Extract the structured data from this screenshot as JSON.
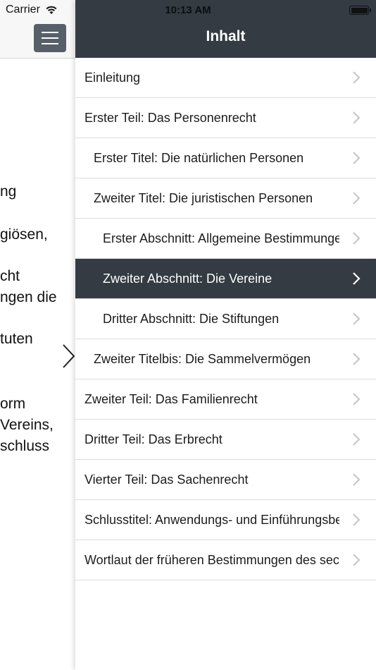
{
  "status_bar": {
    "carrier": "Carrier",
    "time": "10:13 AM"
  },
  "left_pane": {
    "peek_lines": [
      "ng",
      "giösen,",
      "cht",
      "ngen die",
      "tuten",
      "orm",
      "Vereins,",
      "schluss"
    ]
  },
  "menu": {
    "title": "Inhalt",
    "items": [
      {
        "label": "Einleitung",
        "level": 0,
        "selected": false
      },
      {
        "label": "Erster Teil: Das Personenrecht",
        "level": 0,
        "selected": false
      },
      {
        "label": "Erster Titel: Die natürlichen Personen",
        "level": 1,
        "selected": false
      },
      {
        "label": "Zweiter Titel: Die juristischen Personen",
        "level": 1,
        "selected": false
      },
      {
        "label": "Erster Abschnitt: Allgemeine Bestimmungen",
        "level": 2,
        "selected": false
      },
      {
        "label": "Zweiter Abschnitt: Die Vereine",
        "level": 2,
        "selected": true
      },
      {
        "label": "Dritter Abschnitt: Die Stiftungen",
        "level": 2,
        "selected": false
      },
      {
        "label": "Zweiter Titelbis: Die Sammelvermögen",
        "level": 1,
        "selected": false
      },
      {
        "label": "Zweiter Teil: Das Familienrecht",
        "level": 0,
        "selected": false
      },
      {
        "label": "Dritter Teil: Das Erbrecht",
        "level": 0,
        "selected": false
      },
      {
        "label": "Vierter Teil: Das Sachenrecht",
        "level": 0,
        "selected": false
      },
      {
        "label": "Schlusstitel: Anwendungs- und Einführungsbestimmungen",
        "level": 0,
        "selected": false
      },
      {
        "label": "Wortlaut der früheren Bestimmungen des sechsten Titels",
        "level": 0,
        "selected": false
      }
    ]
  },
  "colors": {
    "header_dark": "#343b42",
    "menu_button": "#576069",
    "chevron": "#c7c7cc"
  }
}
